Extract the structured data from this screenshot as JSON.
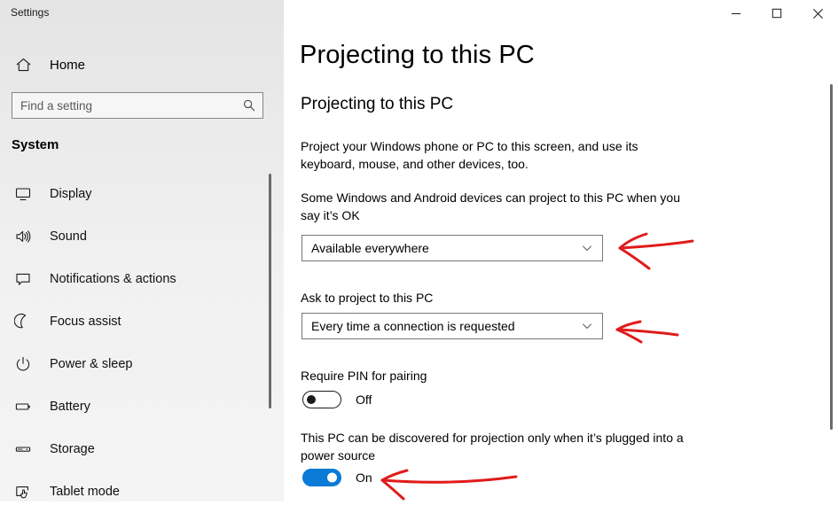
{
  "window": {
    "title": "Settings",
    "controls": [
      {
        "name": "minimize",
        "label": "Minimize"
      },
      {
        "name": "maximize",
        "label": "Maximize"
      },
      {
        "name": "close",
        "label": "Close"
      }
    ]
  },
  "sidebar": {
    "home_label": "Home",
    "home_icon": "home-icon",
    "search": {
      "placeholder": "Find a setting",
      "value": "",
      "icon": "search-icon"
    },
    "section_title": "System",
    "items": [
      {
        "label": "Display",
        "icon": "monitor-icon"
      },
      {
        "label": "Sound",
        "icon": "speaker-icon"
      },
      {
        "label": "Notifications & actions",
        "icon": "speech-bubble-icon"
      },
      {
        "label": "Focus assist",
        "icon": "moon-icon"
      },
      {
        "label": "Power & sleep",
        "icon": "power-icon"
      },
      {
        "label": "Battery",
        "icon": "battery-icon"
      },
      {
        "label": "Storage",
        "icon": "drive-icon"
      },
      {
        "label": "Tablet mode",
        "icon": "tablet-hand-icon"
      }
    ]
  },
  "main": {
    "page_title": "Projecting to this PC",
    "sub_title": "Projecting to this PC",
    "description": "Project your Windows phone or PC to this screen, and use its keyboard, mouse, and other devices, too.",
    "settings": [
      {
        "label": "Some Windows and Android devices can project to this PC when you say it’s OK",
        "control": "dropdown",
        "value": "Available everywhere"
      },
      {
        "label": "Ask to project to this PC",
        "control": "dropdown",
        "value": "Every time a connection is requested"
      },
      {
        "label": "Require PIN for pairing",
        "control": "toggle",
        "state": "Off"
      },
      {
        "label": "This PC can be discovered for projection only when it’s plugged into a power source",
        "control": "toggle",
        "state": "On"
      }
    ]
  },
  "annotations": {
    "color": "#e01b1b",
    "arrows": [
      {
        "name": "arrow-to-availability-dropdown",
        "target": "Available everywhere"
      },
      {
        "name": "arrow-to-ask-dropdown",
        "target": "Every time a connection is requested"
      },
      {
        "name": "arrow-to-power-toggle",
        "target": "On"
      }
    ]
  },
  "colors": {
    "accent": "#0a7ad6",
    "sidebar_bg": "#eeeeee",
    "annotation_red": "#e01b1b",
    "border": "#767676"
  }
}
